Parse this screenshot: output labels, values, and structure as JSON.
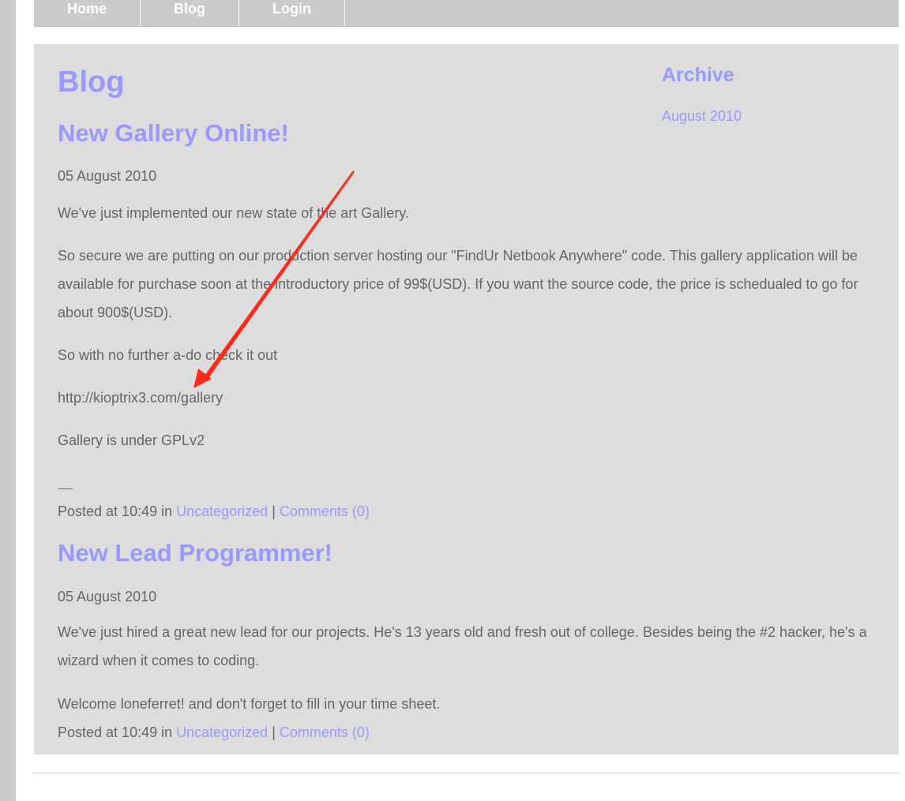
{
  "nav": {
    "items": [
      "Home",
      "Blog",
      "Login"
    ]
  },
  "page_title": "Blog",
  "sidebar": {
    "title": "Archive",
    "link": "August 2010"
  },
  "posts": [
    {
      "title": "New Gallery Online!",
      "date": "05 August 2010",
      "paragraphs": [
        "We've just implemented our new state of the art Gallery.",
        "So secure we are putting on our production server hosting our \"FindUr Netbook Anywhere\" code. This gallery application will be available for purchase soon at the introductory price of 99$(USD). If you want the source code, the price is schedualed to go for about 900$(USD).",
        "So with no further a-do check it out",
        "http://kioptrix3.com/gallery",
        "Gallery is under GPLv2"
      ],
      "posted_prefix": "Posted at 10:49 in ",
      "category": "Uncategorized",
      "separator": " | ",
      "comments": "Comments (0)"
    },
    {
      "title": "New Lead Programmer!",
      "date": "05 August 2010",
      "paragraphs": [
        "We've just hired a great new lead for our projects. He's 13 years old and fresh out of college. Besides being the #2 hacker, he's a wizard when it comes to coding.",
        "Welcome loneferret! and don't forget to fill in your time sheet."
      ],
      "posted_prefix": "Posted at 10:49 in ",
      "category": "Uncategorized",
      "separator": " | ",
      "comments": "Comments (0)"
    }
  ],
  "colors": {
    "link": "#9999ff",
    "text": "#666666",
    "content_bg": "#dddddd",
    "nav_bg": "#cbcbcb",
    "annotation_arrow": "#ff2a1a"
  },
  "annotation": {
    "icon": "red-arrow-icon"
  }
}
